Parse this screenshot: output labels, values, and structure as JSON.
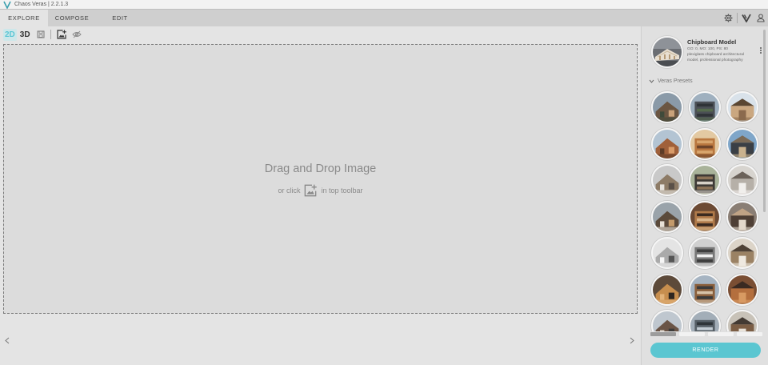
{
  "window": {
    "title": "Chaos Veras | 2.2.1.3"
  },
  "tabs": [
    {
      "label": "EXPLORE",
      "active": true
    },
    {
      "label": "COMPOSE",
      "active": false
    },
    {
      "label": "EDIT",
      "active": false
    }
  ],
  "header_icons": [
    "gear-icon",
    "veras-logo-icon",
    "user-icon"
  ],
  "toolbar": {
    "mode_2d": "2D",
    "mode_3d": "3D",
    "active_mode": "2D",
    "icons": [
      "save-icon",
      "add-image-icon",
      "hide-icon"
    ]
  },
  "dropzone": {
    "title": "Drag and Drop Image",
    "hint_before": "or click",
    "hint_after": "in top toolbar"
  },
  "model": {
    "name": "Chipboard Model",
    "meta": "GO: 0, MO: 100, PS: 80",
    "description": "plexiglass chipboard architectural model, professional photography"
  },
  "presets": {
    "heading": "Veras Presets",
    "count_visible": 21
  },
  "render": {
    "label": "RENDER"
  },
  "colors": {
    "accent": "#5bc6d1",
    "tab_bar": "#cfcfcf",
    "background": "#e4e4e4"
  }
}
